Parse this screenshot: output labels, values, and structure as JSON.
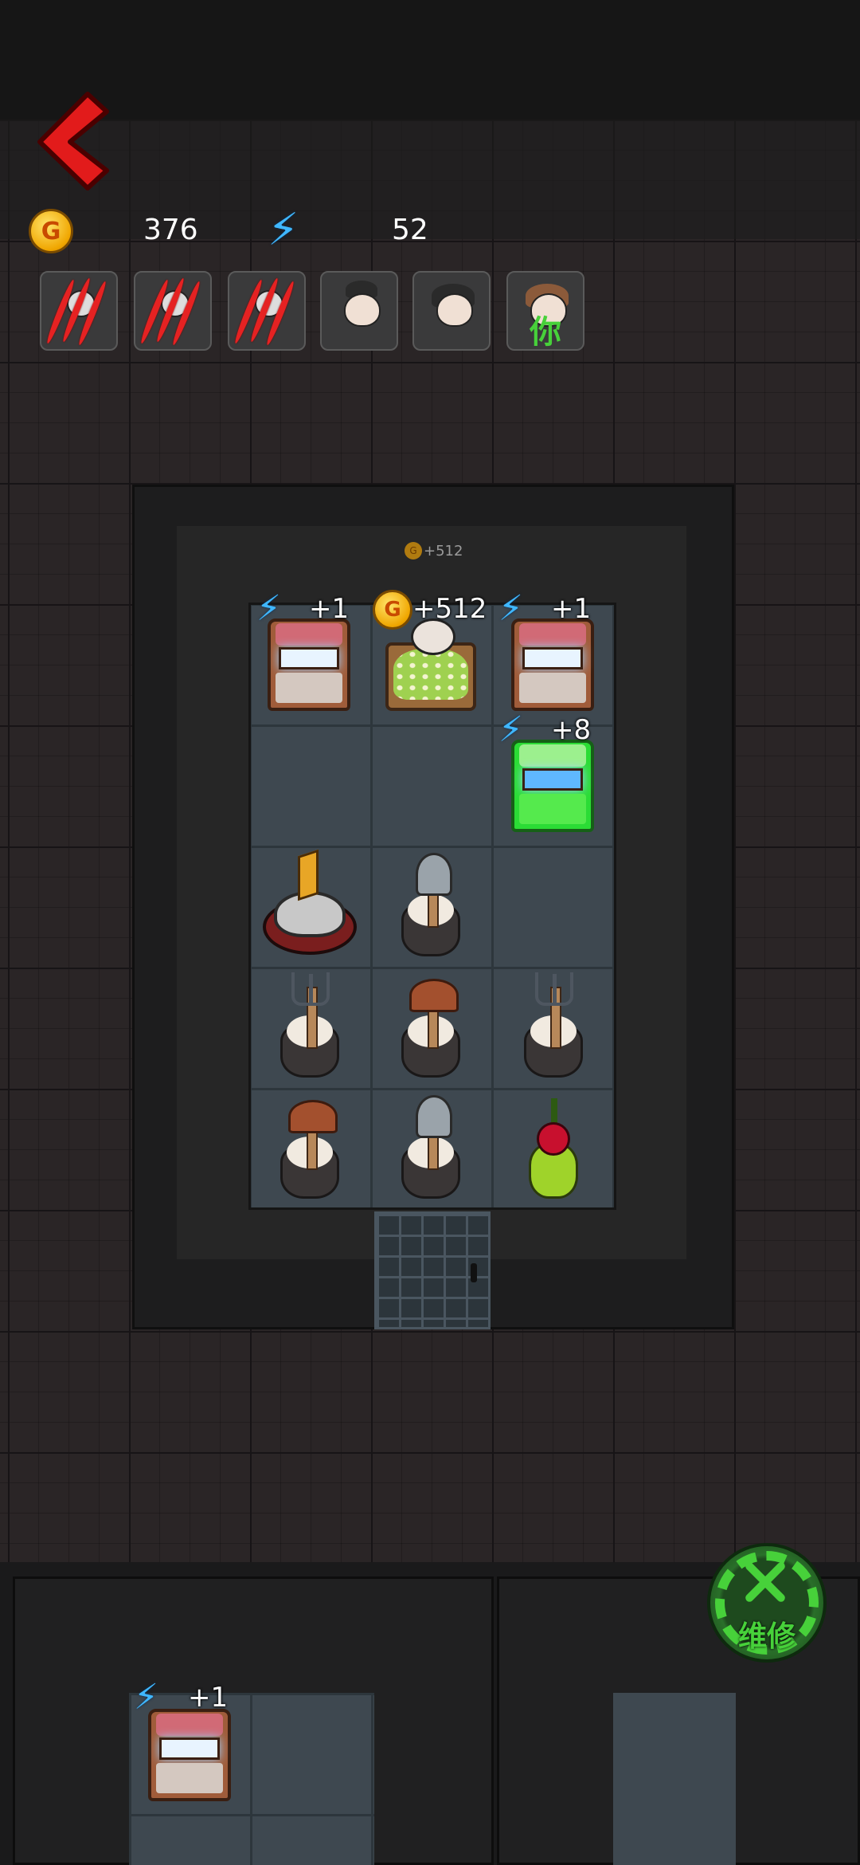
{
  "hud": {
    "gold_icon": "gold-coin-icon",
    "gold_coin_letter": "G",
    "gold": "376",
    "energy_icon": "lightning-icon",
    "energy": "52"
  },
  "slots": [
    {
      "type": "enemy-clawed"
    },
    {
      "type": "enemy-clawed"
    },
    {
      "type": "enemy-clawed"
    },
    {
      "type": "player-avatar"
    },
    {
      "type": "player-avatar"
    },
    {
      "type": "player-avatar-you",
      "label": "你"
    }
  ],
  "room": {
    "floating_gold": "+512",
    "bonuses": {
      "arcade_1": "+1",
      "bed": "+512",
      "arcade_2": "+1",
      "arcade_green": "+8",
      "lower_arcade": "+1"
    }
  },
  "repair_button": {
    "label": "维修",
    "icon": "wrench-gear-icon"
  },
  "colors": {
    "energy": "#3fb7ff",
    "repair": "#47d13a",
    "back": "#e21b1b",
    "claw": "#e52222"
  }
}
